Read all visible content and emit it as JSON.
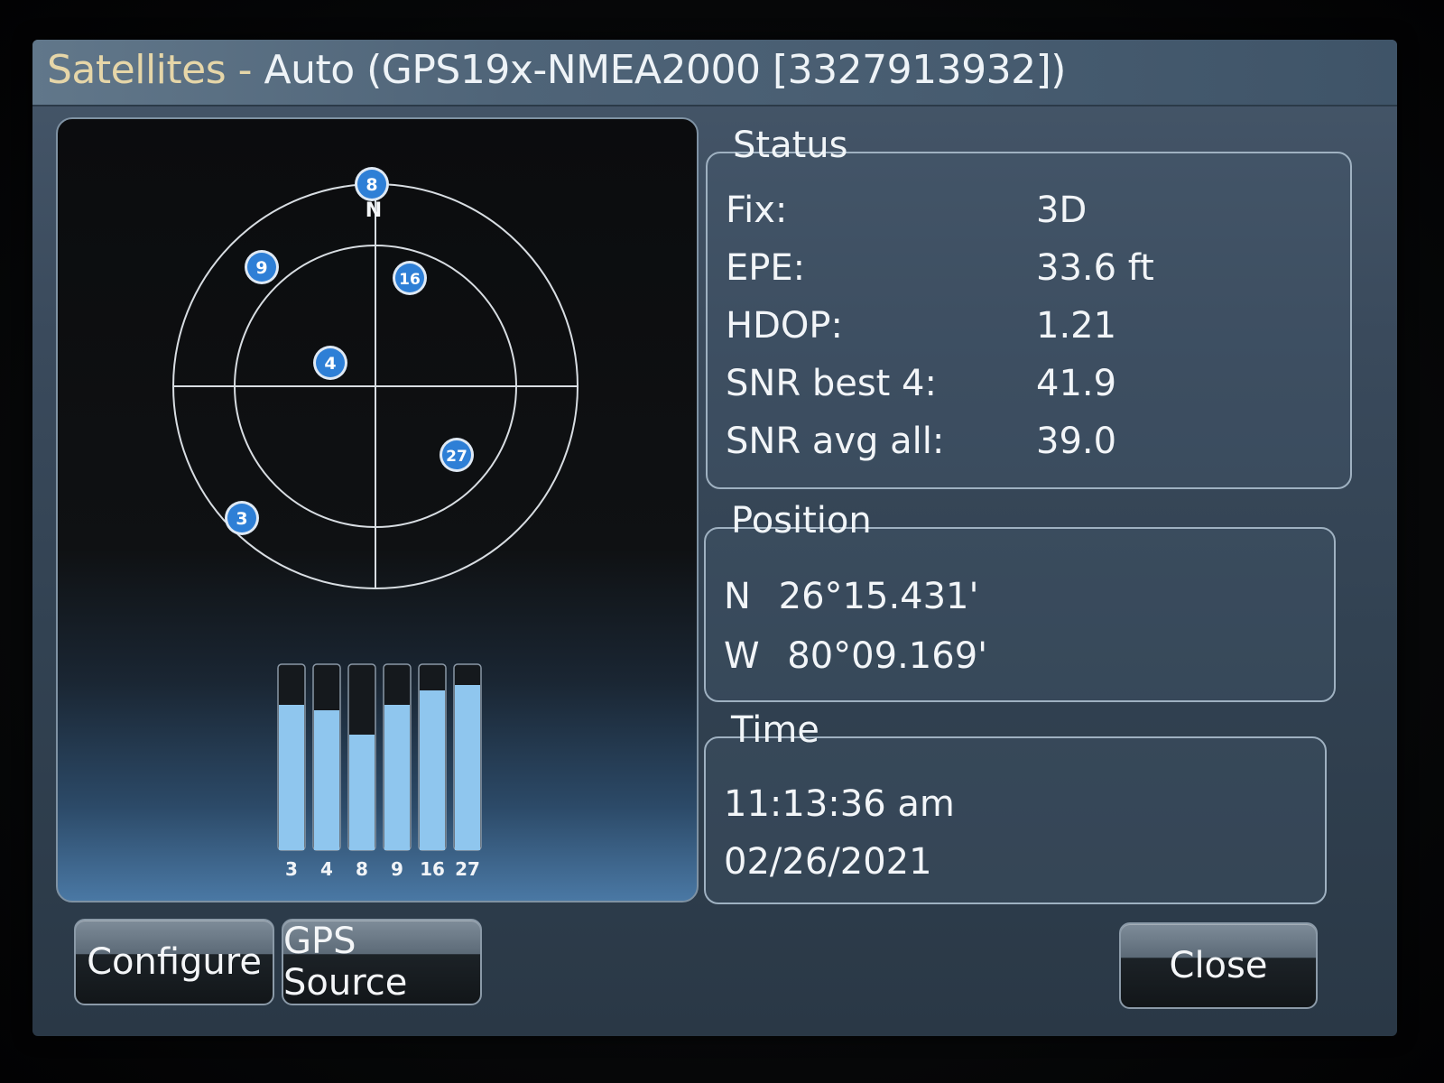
{
  "window": {
    "title_prefix": "Satellites - ",
    "title_main": "Auto (GPS19x-NMEA2000 [3327913932])"
  },
  "skyview": {
    "north_label": "N",
    "satellites": [
      {
        "prn": "8"
      },
      {
        "prn": "9"
      },
      {
        "prn": "16"
      },
      {
        "prn": "4"
      },
      {
        "prn": "27"
      },
      {
        "prn": "3"
      }
    ]
  },
  "signal_bars": {
    "bars": [
      {
        "prn": "3",
        "level": 0.78
      },
      {
        "prn": "4",
        "level": 0.75
      },
      {
        "prn": "8",
        "level": 0.62
      },
      {
        "prn": "9",
        "level": 0.78
      },
      {
        "prn": "16",
        "level": 0.86
      },
      {
        "prn": "27",
        "level": 0.89
      }
    ]
  },
  "status": {
    "legend": "Status",
    "fix_label": "Fix:",
    "fix_value": "3D",
    "epe_label": "EPE:",
    "epe_value": "33.6 ft",
    "hdop_label": "HDOP:",
    "hdop_value": "1.21",
    "snr_best_label": "SNR best 4:",
    "snr_best_value": "41.9",
    "snr_avg_label": "SNR avg all:",
    "snr_avg_value": "39.0"
  },
  "position": {
    "legend": "Position",
    "lat_hemi": "N",
    "lat_value": "26°15.431'",
    "lon_hemi": "W",
    "lon_value": "80°09.169'"
  },
  "time": {
    "legend": "Time",
    "clock": "11:13:36 am",
    "date": "02/26/2021"
  },
  "buttons": {
    "configure": "Configure",
    "gps_source": "GPS Source",
    "close": "Close"
  },
  "colors": {
    "satellite_fill": "#2e7fd6",
    "bar_fill": "#8fc6ee",
    "ring": "#d8dde2"
  }
}
